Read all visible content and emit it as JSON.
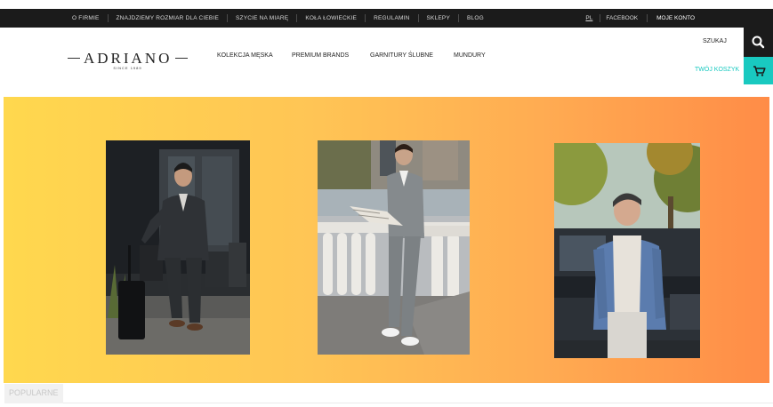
{
  "topbar": {
    "links": [
      "O FIRMIE",
      "ZNAJDZIEMY ROZMIAR DLA CIEBIE",
      "SZYCIE NA MIARĘ",
      "KOŁA ŁOWIECKIE",
      "REGULAMIN",
      "SKLEPY",
      "BLOG"
    ],
    "lang": "PL",
    "facebook": "FACEBOOK",
    "account": "MOJE KONTO"
  },
  "logo": {
    "name": "ADRIANO",
    "since": "SINCE 1989"
  },
  "nav": [
    "KOLEKCJA MĘSKA",
    "PREMIUM BRANDS",
    "GARNITURY ŚLUBNE",
    "MUNDURY"
  ],
  "header": {
    "search_label": "SZUKAJ",
    "cart_label": "TWÓJ KOSZYK"
  },
  "hero": {
    "photos": [
      {
        "icon": "man-dark-suit-with-suitcase-photo"
      },
      {
        "icon": "man-grey-suit-with-newspaper-photo"
      },
      {
        "icon": "man-blue-blazer-by-car-photo"
      }
    ]
  },
  "sections": {
    "popular_label": "POPULARNE"
  },
  "colors": {
    "topbar": "#1b1b1b",
    "accent": "#19c9c0",
    "gradient_start": "#ffd84e",
    "gradient_end": "#ff8c47"
  }
}
